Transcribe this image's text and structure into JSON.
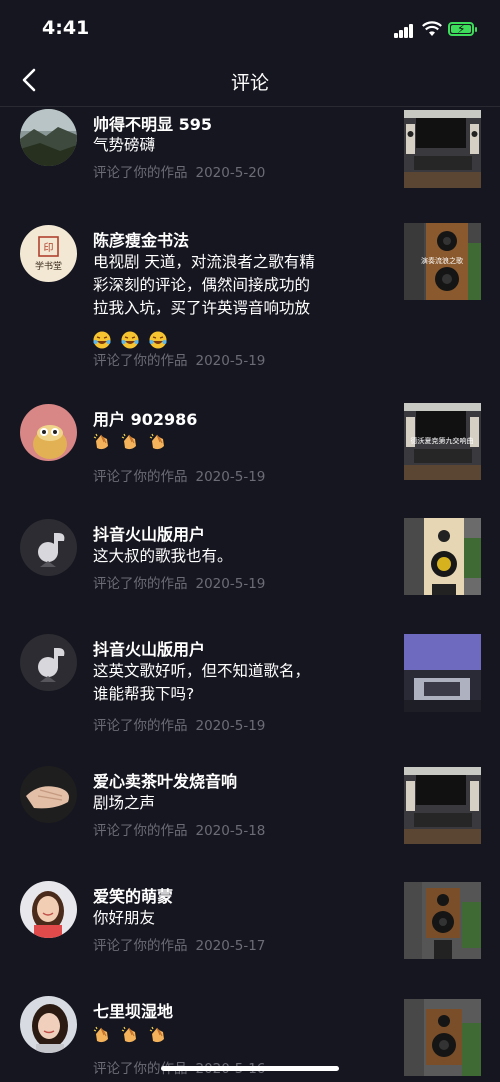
{
  "status": {
    "time": "4:41"
  },
  "header": {
    "title": "评论"
  },
  "comments": [
    {
      "name": "帅得不明显 595",
      "lines": [
        "气势磅礴"
      ],
      "action": "评论了你的作品",
      "date": "2020-5-20"
    },
    {
      "name": "陈彦瘦金书法",
      "lines": [
        "电视剧 天道，对流浪者之歌有精",
        "彩深刻的评论，偶然间接成功的",
        "拉我入坑，买了许英谔音响功放"
      ],
      "emojis": [
        "rofl-emoji",
        "rofl-emoji",
        "rofl-emoji"
      ],
      "action": "评论了你的作品",
      "date": "2020-5-19"
    },
    {
      "name": "用户 902986",
      "lines": [],
      "emojis": [
        "clap-emoji",
        "clap-emoji",
        "clap-emoji"
      ],
      "action": "评论了你的作品",
      "date": "2020-5-19"
    },
    {
      "name": "抖音火山版用户",
      "lines": [
        "这大叔的歌我也有。"
      ],
      "action": "评论了你的作品",
      "date": "2020-5-19"
    },
    {
      "name": "抖音火山版用户",
      "lines": [
        "这英文歌好听，但不知道歌名，",
        "谁能帮我下吗?"
      ],
      "action": "评论了你的作品",
      "date": "2020-5-19"
    },
    {
      "name": "爱心卖茶叶发烧音响",
      "lines": [
        "剧场之声"
      ],
      "action": "评论了你的作品",
      "date": "2020-5-18"
    },
    {
      "name": "爱笑的萌蒙",
      "lines": [
        "你好朋友"
      ],
      "action": "评论了你的作品",
      "date": "2020-5-17"
    },
    {
      "name": "七里坝湿地",
      "lines": [],
      "emojis": [
        "clap-emoji",
        "clap-emoji",
        "clap-emoji"
      ],
      "action": "评论了你的作品",
      "date": "2020-5-16"
    }
  ],
  "avatars": {
    "calligraphy_text": "学书堂"
  },
  "thumbnails": {
    "caption_2": "演奏流浪之歌",
    "caption_3": "德沃夏克第九交响曲"
  },
  "colors": {
    "background": "#161620",
    "meta_text": "#6c6c76",
    "battery": "#3ddc5a"
  }
}
